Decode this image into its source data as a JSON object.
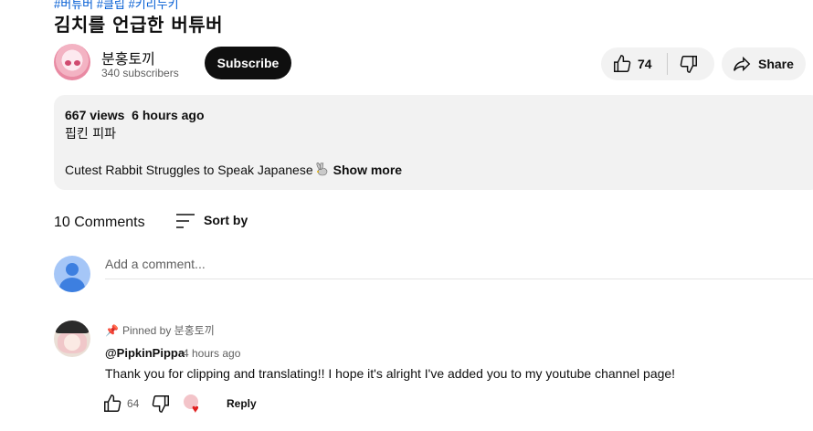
{
  "video": {
    "hashtags": "#버튜버 #클립 #키리누키",
    "title": "김치를 언급한 버튜버"
  },
  "channel": {
    "name": "분홍토끼",
    "subscribers": "340 subscribers",
    "subscribe_label": "Subscribe"
  },
  "actions": {
    "like_count": "74",
    "share_label": "Share"
  },
  "description": {
    "meta": "667 views  6 hours ago",
    "line1": "핍킨 피파",
    "line2": "Cutest Rabbit Struggles to Speak Japanese",
    "show_more": "Show more"
  },
  "comments": {
    "count_label": "10 Comments",
    "sort_label": "Sort by",
    "add_placeholder": "Add a comment...",
    "items": [
      {
        "pinned": "Pinned by 분홍토끼",
        "author": "@PipkinPippa",
        "time": "4 hours ago",
        "text": "Thank you for clipping and translating!! I hope it's alright I've added you to my youtube channel page!",
        "likes": "64",
        "reply_label": "Reply"
      }
    ]
  },
  "colors": {
    "accent_link": "#065fd4",
    "chip_bg": "#f2f2f2",
    "heart": "#e01f1f"
  }
}
